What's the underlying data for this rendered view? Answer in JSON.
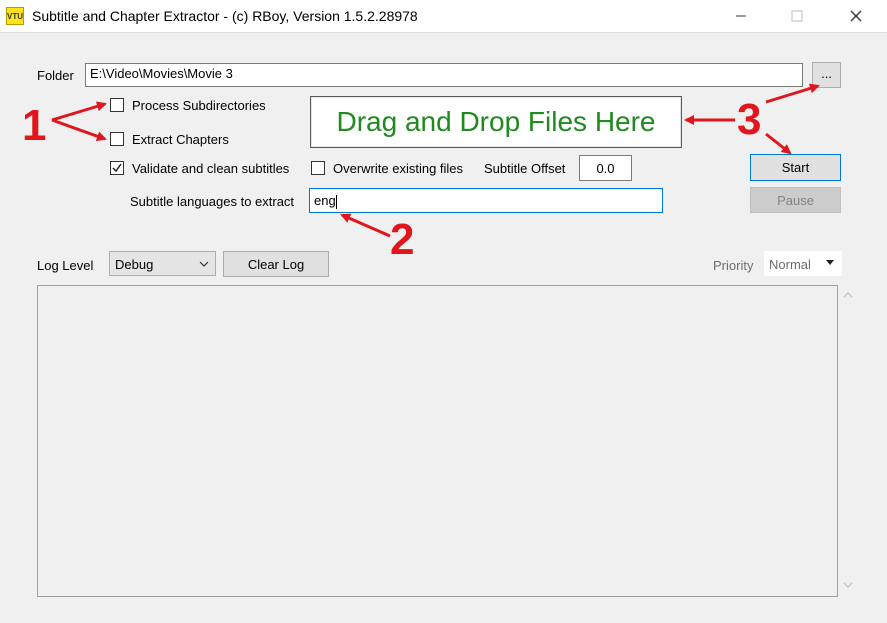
{
  "window": {
    "title": "Subtitle and Chapter Extractor - (c) RBoy, Version 1.5.2.28978",
    "app_icon_text": "VTU"
  },
  "form": {
    "folder_label": "Folder",
    "folder_value": "E:\\Video\\Movies\\Movie 3",
    "browse_label": "...",
    "process_subdirs_label": "Process Subdirectories",
    "process_subdirs_checked": false,
    "extract_chapters_label": "Extract Chapters",
    "extract_chapters_checked": false,
    "validate_label": "Validate and clean subtitles",
    "validate_checked": true,
    "overwrite_label": "Overwrite existing files",
    "overwrite_checked": false,
    "offset_label": "Subtitle Offset",
    "offset_value": "0.0",
    "languages_label": "Subtitle languages to extract",
    "languages_value": "eng",
    "dropzone_text": "Drag and Drop Files Here",
    "start_label": "Start",
    "pause_label": "Pause"
  },
  "log": {
    "level_label": "Log Level",
    "level_value": "Debug",
    "clear_label": "Clear Log",
    "priority_label": "Priority",
    "priority_value": "Normal"
  },
  "annotations": {
    "one": "1",
    "two": "2",
    "three": "3",
    "color": "#e0161d"
  }
}
